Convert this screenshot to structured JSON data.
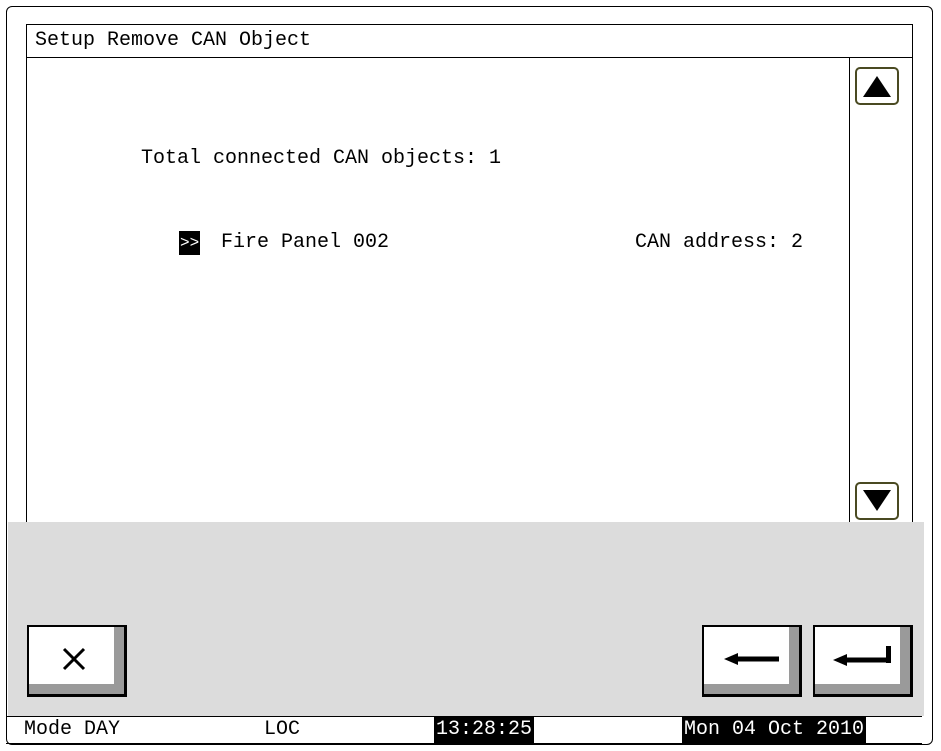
{
  "title": "Setup Remove CAN Object",
  "main": {
    "total_line": "Total connected CAN objects: 1",
    "items": [
      {
        "marker": ">>",
        "name": "Fire Panel 002",
        "address": "CAN address: 2"
      }
    ]
  },
  "scroll": {
    "up_icon": "triangle-up-icon",
    "down_icon": "triangle-down-icon"
  },
  "buttons": {
    "cancel_icon": "close-icon",
    "back_icon": "arrow-left-icon",
    "enter_icon": "enter-return-icon"
  },
  "status": {
    "mode": "Mode DAY",
    "loc": "LOC",
    "time": "13:28:25",
    "date": "Mon 04 Oct 2010"
  },
  "colors": {
    "highlight_bg": "#000000",
    "highlight_fg": "#ffffff",
    "panel_gray": "#dcdcdc",
    "scroll_border": "#4a4a22"
  }
}
